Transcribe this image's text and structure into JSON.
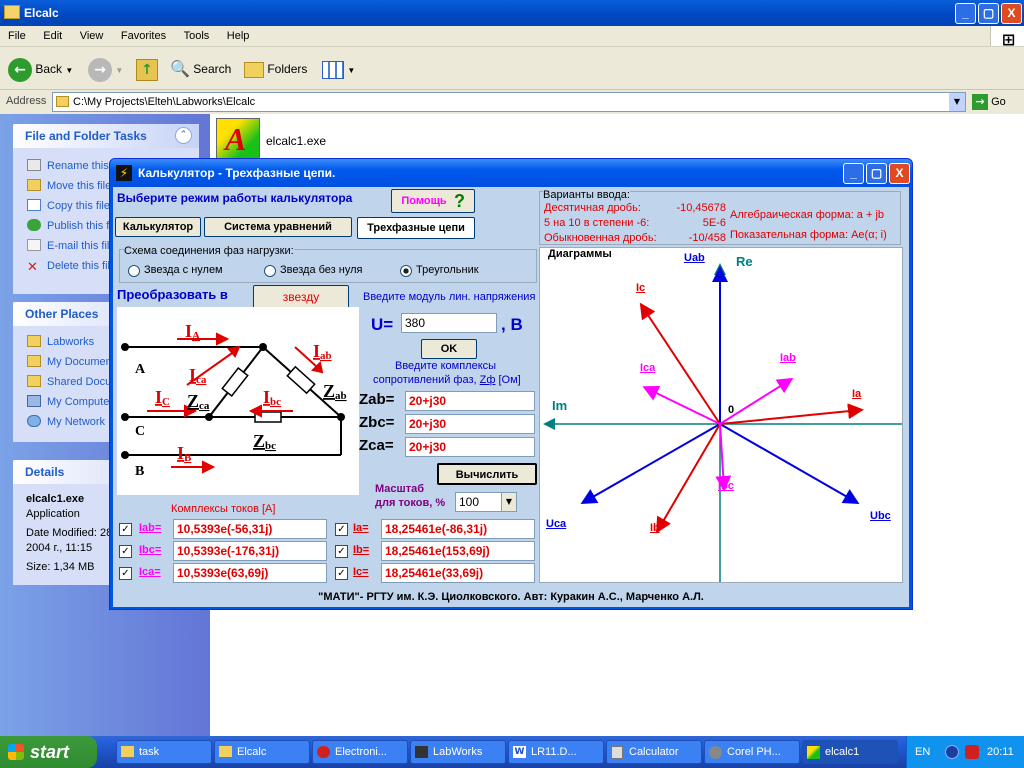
{
  "window": {
    "title": "Elcalc",
    "min": "_",
    "max": "▢",
    "close": "X"
  },
  "menu": [
    "File",
    "Edit",
    "View",
    "Favorites",
    "Tools",
    "Help"
  ],
  "toolbar": {
    "back": "Back",
    "search": "Search",
    "folders": "Folders"
  },
  "address": {
    "label": "Address",
    "value": "C:\\My Projects\\Elteh\\Labworks\\Elcalc",
    "go": "Go"
  },
  "tasks": {
    "title": "File and Folder Tasks",
    "items": [
      "Rename this file",
      "Move this file",
      "Copy this file",
      "Publish this file",
      "E-mail this file",
      "Delete this file"
    ]
  },
  "other_places": {
    "title": "Other Places",
    "items": [
      "Labworks",
      "My Documents",
      "Shared Documents",
      "My Computer",
      "My Network"
    ]
  },
  "details": {
    "title": "Details",
    "name": "elcalc1.exe",
    "type": "Application",
    "modified": "Date Modified: 28",
    "modified2": "2004 г., 11:15",
    "size": "Size: 1,34 MB"
  },
  "file": {
    "name": "elcalc1.exe"
  },
  "app": {
    "title": "Калькулятор - Трехфазные цепи.",
    "mode_prompt": "Выберите режим работы калькулятора",
    "help": "Помощь",
    "help_icon": "?",
    "tabs": [
      "Калькулятор",
      "Система уравнений",
      "Трехфазные цепи"
    ],
    "input_variants": {
      "title": "Варианты ввода:",
      "rows": [
        {
          "label": "Десятичная дробь:",
          "value": "-10,45678"
        },
        {
          "label": "5 на 10 в степени -6:",
          "value": "5E-6"
        },
        {
          "label": "Обыкновенная дробь:",
          "value": "-10/458"
        }
      ],
      "alg": "Алгебраическая форма: a + jb",
      "exp": "Показательная форма: Ae(α; i)"
    },
    "scheme": {
      "title": "Схема соединения фаз нагрузки:",
      "options": [
        "Звезда с нулем",
        "Звезда без нуля",
        "Треугольник"
      ],
      "selected": 2
    },
    "convert": {
      "label": "Преобразовать в",
      "button": "звезду"
    },
    "voltage": {
      "prompt": "Введите модуль лин. напряжения",
      "u_label": "U=",
      "value": "380",
      "unit": ", В",
      "ok": "OK"
    },
    "impedance": {
      "prompt1": "Введите комплексы",
      "prompt2_a": "сопротивлений фаз,",
      "prompt2_z": "Zф",
      "prompt2_b": "[Ом]",
      "rows": [
        {
          "label": "Zab=",
          "value": "20+j30"
        },
        {
          "label": "Zbc=",
          "value": "20+j30"
        },
        {
          "label": "Zca=",
          "value": "20+j30"
        }
      ]
    },
    "calc": "Вычислить",
    "scale": {
      "label1": "Масштаб",
      "label2": "для токов, %",
      "value": "100"
    },
    "currents": {
      "title": "Комплексы токов [A]",
      "phase": [
        {
          "label": "Iab=",
          "value": "10,5393e(-56,31j)"
        },
        {
          "label": "Ibc=",
          "value": "10,5393e(-176,31j)"
        },
        {
          "label": "Ica=",
          "value": "10,5393e(63,69j)"
        }
      ],
      "line": [
        {
          "label": "Ia=",
          "value": "18,25461e(-86,31j)"
        },
        {
          "label": "Ib=",
          "value": "18,25461e(153,69j)"
        },
        {
          "label": "Ic=",
          "value": "18,25461e(33,69j)"
        }
      ]
    },
    "circuit": {
      "nodes": [
        "A",
        "C",
        "B"
      ],
      "Ia": "I",
      "Ia_sub": "A",
      "Ica": "I",
      "Ica_sub": "ca",
      "Iab": "I",
      "Iab_sub": "ab",
      "Ic": "I",
      "Ic_sub": "C",
      "Zca": "Z",
      "Zca_sub": "ca",
      "Ibc": "I",
      "Ibc_sub": "bc",
      "Zab": "Z",
      "Zab_sub": "ab",
      "Zbc": "Z",
      "Zbc_sub": "bc",
      "Ib": "I",
      "Ib_sub": "B"
    },
    "diagram": {
      "title": "Диаграммы",
      "re": "Re",
      "im": "Im",
      "zero": "0",
      "labels": {
        "Uab": "Uab",
        "Ubc": "Ubc",
        "Uca": "Uca",
        "Ia": "Ia",
        "Ib": "Ib",
        "Ic": "Ic",
        "Iab": "Iab",
        "Ibc": "Ibc",
        "Ica": "Ica"
      },
      "colors": {
        "voltage": "#0000e0",
        "line_current": "#e00000",
        "phase_current": "#ff00ff",
        "axis": "#008080"
      }
    },
    "footer": "\"МАТИ\"- РГТУ им. К.Э. Циолковского. Авт: Куракин А.С., Марченко А.Л."
  },
  "taskbar": {
    "start": "start",
    "items": [
      "task",
      "Elcalc",
      "Electroni...",
      "LabWorks",
      "LR11.D...",
      "Calculator",
      "Corel PH...",
      "elcalc1"
    ],
    "lang": "EN",
    "time": "20:11"
  }
}
